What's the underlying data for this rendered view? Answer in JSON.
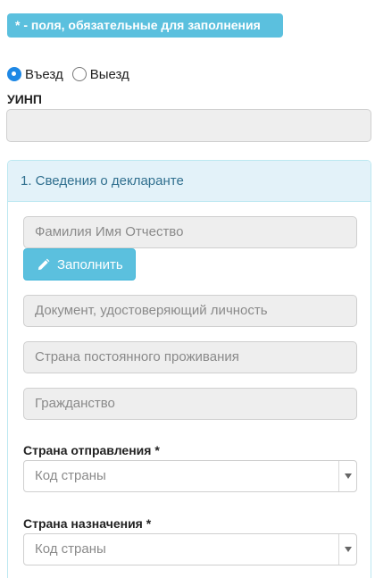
{
  "required_note": "* - поля, обязательные для заполнения",
  "direction": {
    "options": [
      {
        "label": "Въезд",
        "checked": true
      },
      {
        "label": "Выезд",
        "checked": false
      }
    ]
  },
  "uinp": {
    "label": "УИНП",
    "value": ""
  },
  "declarant": {
    "title": "1. Сведения о декларанте",
    "full_name_placeholder": "Фамилия Имя Отчество",
    "fill_button": "Заполнить",
    "document_placeholder": "Документ, удостоверяющий личность",
    "residence_country_placeholder": "Страна постоянного проживания",
    "citizenship_placeholder": "Гражданство",
    "departure_country": {
      "label": "Страна отправления *",
      "placeholder": "Код страны"
    },
    "destination_country": {
      "label": "Страна назначения *",
      "placeholder": "Код страны"
    }
  },
  "icons": {
    "fill_button": "pencil-icon",
    "select_arrow": "caret-down-icon"
  },
  "colors": {
    "info": "#5bc0de",
    "radio_checked": "#1e88e5",
    "panel_heading_bg": "#e3f2f9",
    "panel_heading_text": "#31708f"
  }
}
